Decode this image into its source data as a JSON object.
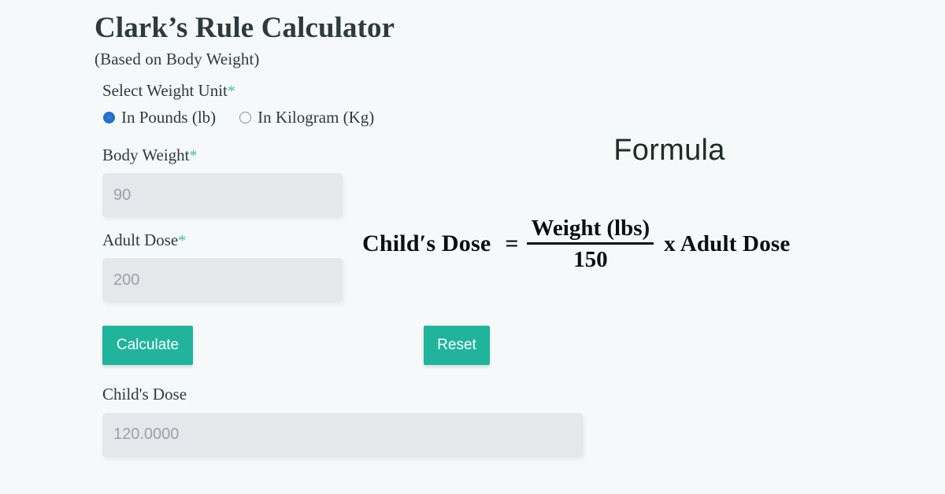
{
  "page": {
    "title": "Clark’s Rule Calculator",
    "subtitle": "(Based on Body Weight)",
    "background_color": "#f6f9fa",
    "accent_color": "#20b49d",
    "required_star_color": "#3fbfa4",
    "radio_selected_color": "#1f6fd0"
  },
  "form": {
    "weight_unit": {
      "label": "Select Weight Unit",
      "required_marker": "*",
      "selected": "In Pounds (lb)",
      "options": [
        {
          "label": "In Pounds (lb)",
          "checked": true
        },
        {
          "label": "In Kilogram (Kg)",
          "checked": false
        }
      ]
    },
    "body_weight": {
      "label": "Body Weight",
      "required_marker": "*",
      "value": "90"
    },
    "adult_dose": {
      "label": "Adult Dose",
      "required_marker": "*",
      "value": "200"
    },
    "buttons": {
      "calculate": "Calculate",
      "reset": "Reset"
    },
    "result": {
      "label": "Child's Dose",
      "value": "120.0000"
    }
  },
  "formula": {
    "heading": "Formula",
    "left_side": "Child′s Dose",
    "equals": "=",
    "numerator": "Weight (lbs)",
    "denominator": "150",
    "right_side": "x Adult Dose"
  }
}
